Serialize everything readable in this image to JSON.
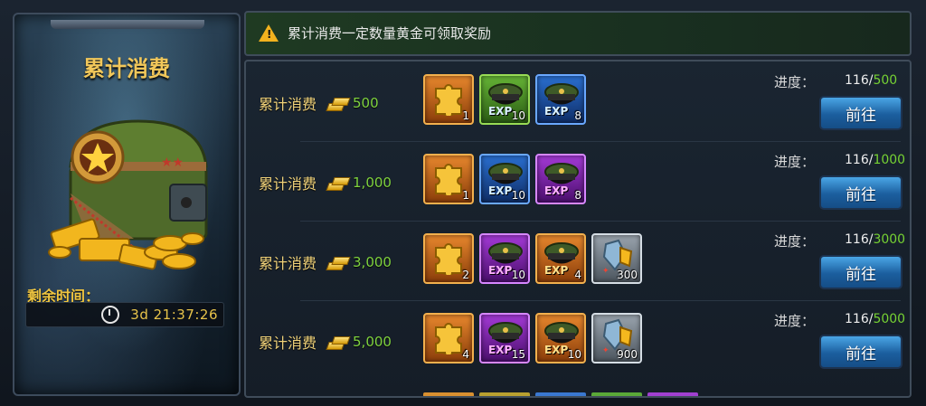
{
  "left_panel": {
    "title": "累计消费",
    "time_label": "剩余时间：",
    "time_value": "3d  21:37:26"
  },
  "notice": {
    "text": "累计消费一定数量黄金可领取奖励"
  },
  "progress_label": "进度：",
  "go_label": "前往",
  "row_label": "累计消费",
  "rows": [
    {
      "amount": "500",
      "progress_current": "116",
      "progress_total": "500",
      "items": [
        {
          "color": "orange",
          "icon": "puzzle-icon",
          "count": "1",
          "exp": ""
        },
        {
          "color": "green",
          "icon": "officer-hat-icon",
          "count": "10",
          "exp": "EXP"
        },
        {
          "color": "blue",
          "icon": "officer-hat-icon",
          "count": "8",
          "exp": "EXP"
        }
      ]
    },
    {
      "amount": "1,000",
      "progress_current": "116",
      "progress_total": "1000",
      "items": [
        {
          "color": "orange",
          "icon": "puzzle-icon",
          "count": "1",
          "exp": ""
        },
        {
          "color": "blue",
          "icon": "officer-hat-icon",
          "count": "10",
          "exp": "EXP"
        },
        {
          "color": "purple",
          "icon": "officer-hat-icon",
          "count": "8",
          "exp": "EXP"
        }
      ]
    },
    {
      "amount": "3,000",
      "progress_current": "116",
      "progress_total": "3000",
      "items": [
        {
          "color": "orange",
          "icon": "puzzle-icon",
          "count": "2",
          "exp": ""
        },
        {
          "color": "purple",
          "icon": "officer-hat-icon",
          "count": "10",
          "exp": "EXP"
        },
        {
          "color": "orange",
          "icon": "officer-hat-icon",
          "count": "4",
          "exp": "EXP"
        },
        {
          "color": "gray",
          "icon": "crystal-icon",
          "count": "300",
          "exp": ""
        }
      ]
    },
    {
      "amount": "5,000",
      "progress_current": "116",
      "progress_total": "5000",
      "items": [
        {
          "color": "orange",
          "icon": "puzzle-icon",
          "count": "4",
          "exp": ""
        },
        {
          "color": "purple",
          "icon": "officer-hat-icon",
          "count": "15",
          "exp": "EXP"
        },
        {
          "color": "orange",
          "icon": "officer-hat-icon",
          "count": "10",
          "exp": "EXP"
        },
        {
          "color": "gray",
          "icon": "crystal-icon",
          "count": "900",
          "exp": ""
        }
      ]
    }
  ]
}
